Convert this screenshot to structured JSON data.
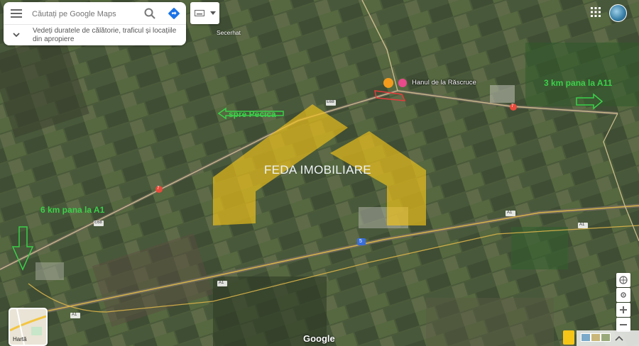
{
  "search": {
    "placeholder": "Căutați pe Google Maps",
    "suggestion": "Vedeți duratele de călătorie, traficul și locațiile din apropiere"
  },
  "watermark": "FEDA IMOBILIARE",
  "place": {
    "name": "Hanul de la Răscruce"
  },
  "village": "Secerhat",
  "road_labels": {
    "e68_a": "E68",
    "e68_b": "E68",
    "r7_a": "7",
    "r7_b": "7",
    "a1_a": "A1",
    "a1_b": "A1",
    "a1_c": "A1",
    "a1_d": "A1",
    "r5": "5"
  },
  "annotations": {
    "spre_pecica": "spre Pecica",
    "to_a11": "3 km pana la A11",
    "to_a1": "6 km pana la A1"
  },
  "map_type_label": "Hartă",
  "brand": "Google",
  "colors": {
    "annotation": "#3bd04a",
    "watermark_shape": "#f5c518",
    "pin": "#e84a8a",
    "road": "#d9b44a"
  },
  "icons": [
    "menu-icon",
    "search-icon",
    "directions-icon",
    "keyboard-icon",
    "chevron-down-icon",
    "apps-grid-icon",
    "compass-icon",
    "location-icon",
    "zoom-in-icon",
    "zoom-out-icon",
    "pegman-icon",
    "place-pin-icon",
    "restaurant-pin-icon",
    "arrow-icon"
  ]
}
